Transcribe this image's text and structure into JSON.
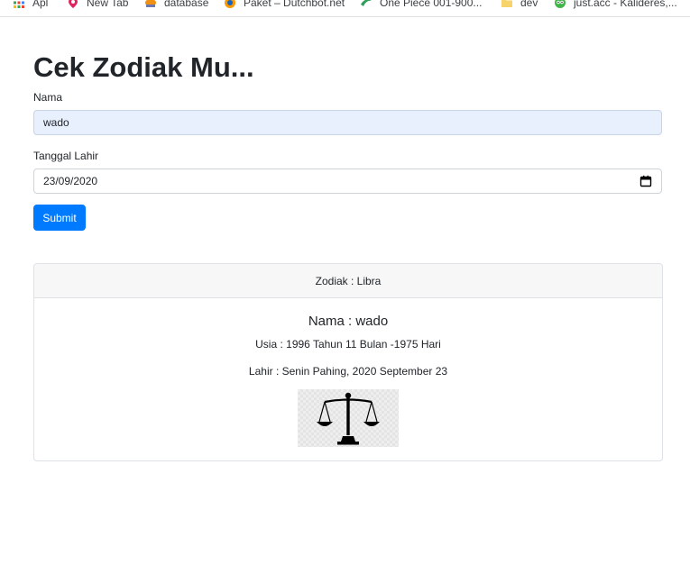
{
  "bookmarks": [
    {
      "label": "Apl",
      "icon": "apps-grid-icon"
    },
    {
      "label": "New Tab",
      "icon": "red-pin-icon"
    },
    {
      "label": "database",
      "icon": "phpmyadmin-icon"
    },
    {
      "label": "Paket – Dutchbot.net",
      "icon": "dutchbot-icon"
    },
    {
      "label": "One Piece 001-900...",
      "icon": "green-swoosh-icon"
    },
    {
      "label": "dev",
      "icon": "folder-icon"
    },
    {
      "label": "just.acc - Kalideres,...",
      "icon": "tokopedia-owl-icon"
    }
  ],
  "page": {
    "title": "Cek Zodiak Mu..."
  },
  "form": {
    "name_label": "Nama",
    "name_value": "wado",
    "dob_label": "Tanggal Lahir",
    "dob_value": "23/09/2020",
    "submit_label": "Submit"
  },
  "result": {
    "header": "Zodiak : Libra",
    "title": "Nama : wado",
    "age": "Usia : 1996 Tahun 11 Bulan -1975 Hari",
    "birth": "Lahir : Senin Pahing, 2020 September 23",
    "image_icon": "libra-scales-icon"
  },
  "colors": {
    "primary": "#007bff",
    "autofill_bg": "#e8f0fe",
    "card_header_bg": "#f7f7f7"
  }
}
